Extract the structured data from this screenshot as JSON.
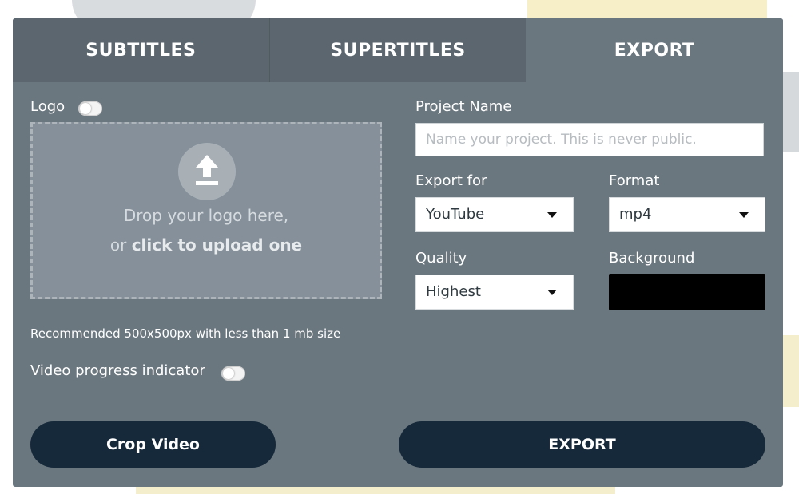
{
  "tabs": [
    {
      "label": "SUBTITLES"
    },
    {
      "label": "SUPERTITLES"
    },
    {
      "label": "EXPORT"
    }
  ],
  "logo": {
    "label": "Logo",
    "toggle_on": false,
    "dropzone": {
      "icon": "upload-icon",
      "line1": "Drop your logo here,",
      "line2_prefix": "or ",
      "line2_link": "click to upload one"
    },
    "hint": "Recommended 500x500px with less than 1 mb size"
  },
  "progress_indicator": {
    "label": "Video progress indicator",
    "toggle_on": false
  },
  "project": {
    "label": "Project Name",
    "value": "",
    "placeholder": "Name your project. This is never public."
  },
  "export_for": {
    "label": "Export for",
    "selected": "YouTube"
  },
  "format": {
    "label": "Format",
    "selected": "mp4"
  },
  "quality": {
    "label": "Quality",
    "selected": "Highest"
  },
  "background": {
    "label": "Background",
    "color": "#000000"
  },
  "buttons": {
    "crop": "Crop Video",
    "export": "EXPORT"
  },
  "colors": {
    "panel": "#6b777f",
    "tab_inactive": "#5b666e",
    "button": "#16293a"
  }
}
